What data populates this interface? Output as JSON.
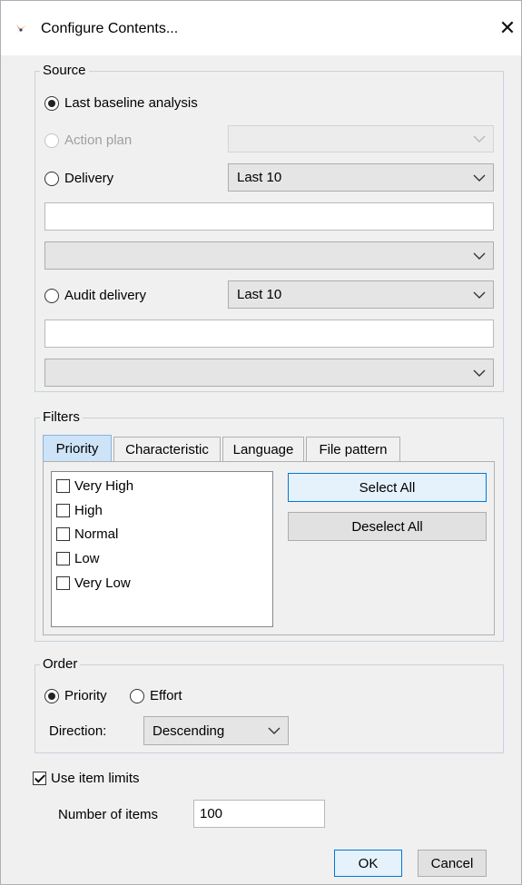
{
  "window": {
    "title": "Configure Contents..."
  },
  "source": {
    "label": "Source",
    "last_baseline": {
      "label": "Last baseline analysis",
      "checked": true
    },
    "action_plan": {
      "label": "Action plan",
      "disabled": true,
      "select_value": ""
    },
    "delivery": {
      "label": "Delivery",
      "select_value": "Last 10",
      "text_value": "",
      "second_select_value": ""
    },
    "audit_delivery": {
      "label": "Audit delivery",
      "select_value": "Last 10",
      "text_value": "",
      "second_select_value": ""
    }
  },
  "filters": {
    "label": "Filters",
    "tabs": [
      {
        "label": "Priority",
        "active": true
      },
      {
        "label": "Characteristic"
      },
      {
        "label": "Language"
      },
      {
        "label": "File pattern"
      }
    ],
    "items": [
      {
        "label": "Very High",
        "checked": false
      },
      {
        "label": "High",
        "checked": false
      },
      {
        "label": "Normal",
        "checked": false
      },
      {
        "label": "Low",
        "checked": false
      },
      {
        "label": "Very Low",
        "checked": false
      }
    ],
    "select_all": "Select All",
    "deselect_all": "Deselect All"
  },
  "order": {
    "label": "Order",
    "priority": {
      "label": "Priority",
      "checked": true
    },
    "effort": {
      "label": "Effort",
      "checked": false
    },
    "direction_label": "Direction:",
    "direction_value": "Descending"
  },
  "limits": {
    "use_item_limits": {
      "label": "Use item limits",
      "checked": true
    },
    "number_label": "Number of items",
    "number_value": "100"
  },
  "buttons": {
    "ok": "OK",
    "cancel": "Cancel"
  }
}
